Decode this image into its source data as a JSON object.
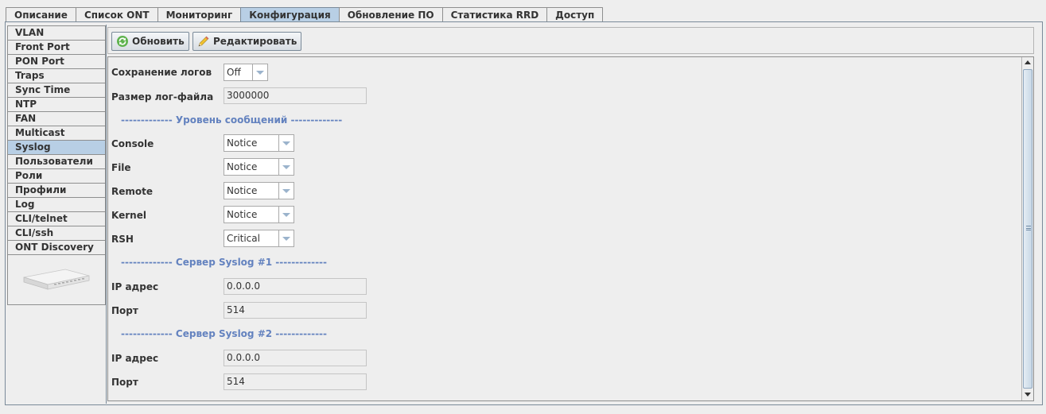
{
  "tabs": [
    {
      "label": "Описание",
      "active": false
    },
    {
      "label": "Список ONT",
      "active": false
    },
    {
      "label": "Мониторинг",
      "active": false
    },
    {
      "label": "Конфигурация",
      "active": true
    },
    {
      "label": "Обновление ПО",
      "active": false
    },
    {
      "label": "Статистика RRD",
      "active": false
    },
    {
      "label": "Доступ",
      "active": false
    }
  ],
  "sidebar": {
    "items": [
      {
        "label": "VLAN"
      },
      {
        "label": "Front Port"
      },
      {
        "label": "PON Port"
      },
      {
        "label": "Traps"
      },
      {
        "label": "Sync Time"
      },
      {
        "label": "NTP"
      },
      {
        "label": "FAN"
      },
      {
        "label": "Multicast"
      },
      {
        "label": "Syslog"
      },
      {
        "label": "Пользователи"
      },
      {
        "label": "Роли"
      },
      {
        "label": "Профили"
      },
      {
        "label": "Log"
      },
      {
        "label": "CLI/telnet"
      },
      {
        "label": "CLI/ssh"
      },
      {
        "label": "ONT Discovery"
      }
    ],
    "active_index": 8,
    "device_image_icon": "olt-device-icon"
  },
  "toolbar": {
    "refresh_label": "Обновить",
    "refresh_icon": "refresh-icon",
    "edit_label": "Редактировать",
    "edit_icon": "pencil-icon"
  },
  "form": {
    "log_save": {
      "label": "Сохранение логов",
      "value": "Off"
    },
    "log_size": {
      "label": "Размер лог-файла",
      "value": "3000000"
    },
    "level_section": "------------- Уровень сообщений -------------",
    "levels": {
      "console": {
        "label": "Console",
        "value": "Notice"
      },
      "file": {
        "label": "File",
        "value": "Notice"
      },
      "remote": {
        "label": "Remote",
        "value": "Notice"
      },
      "kernel": {
        "label": "Kernel",
        "value": "Notice"
      },
      "rsh": {
        "label": "RSH",
        "value": "Critical"
      }
    },
    "server1_section": "------------- Сервер Syslog #1 -------------",
    "server1": {
      "ip_label": "IP адрес",
      "ip_value": "0.0.0.0",
      "port_label": "Порт",
      "port_value": "514"
    },
    "server2_section": "------------- Сервер Syslog #2 -------------",
    "server2": {
      "ip_label": "IP адрес",
      "ip_value": "0.0.0.0",
      "port_label": "Порт",
      "port_value": "514"
    }
  },
  "colors": {
    "accent": "#b8cfe5",
    "section_text": "#6382bf",
    "border": "#7a8a99"
  }
}
